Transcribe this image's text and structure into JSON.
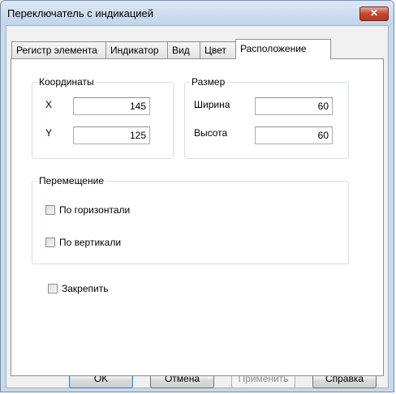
{
  "window": {
    "title": "Переключатель с индикацией",
    "close_glyph": "✕"
  },
  "tabs": [
    {
      "label": "Регистр элемента",
      "active": false
    },
    {
      "label": "Индикатор",
      "active": false
    },
    {
      "label": "Вид",
      "active": false
    },
    {
      "label": "Цвет",
      "active": false
    },
    {
      "label": "Расположение",
      "active": true
    }
  ],
  "coordinates": {
    "title": "Координаты",
    "x_label": "X",
    "x_value": "145",
    "y_label": "Y",
    "y_value": "125"
  },
  "size": {
    "title": "Размер",
    "width_label": "Ширина",
    "width_value": "60",
    "height_label": "Высота",
    "height_value": "60"
  },
  "movement": {
    "title": "Перемещение",
    "horizontal_label": "По горизонтали",
    "horizontal_checked": false,
    "vertical_label": "По вертикали",
    "vertical_checked": false
  },
  "pin": {
    "label": "Закрепить",
    "checked": false
  },
  "buttons": {
    "ok": "OK",
    "cancel": "Отмена",
    "apply": "Применить",
    "help": "Справка"
  }
}
